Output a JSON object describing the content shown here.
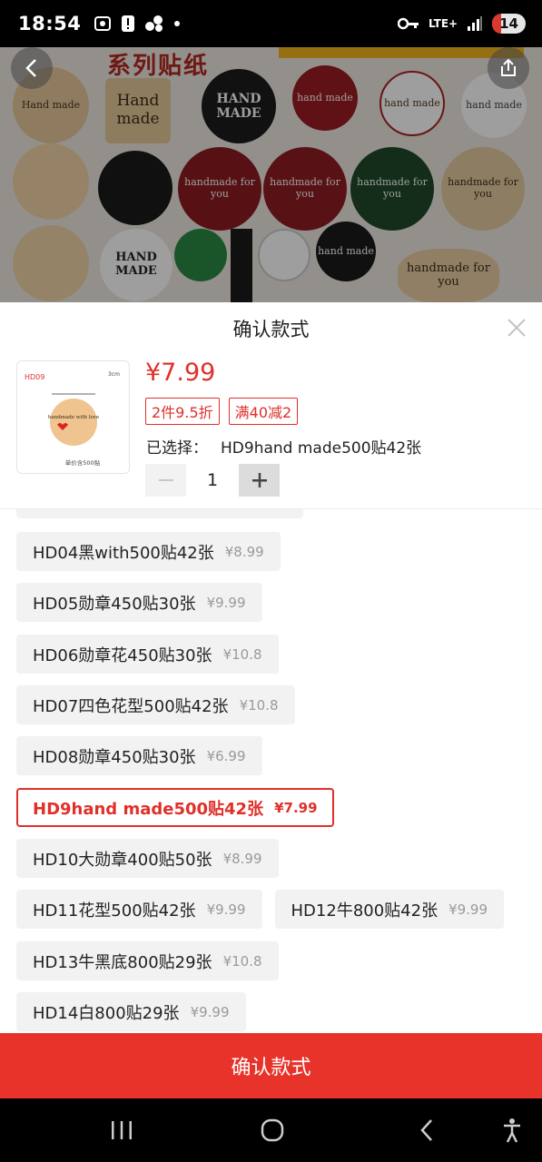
{
  "status_bar": {
    "time": "18:54",
    "network": "LTE+",
    "battery": "14",
    "icons": [
      "screenshot-icon",
      "alert-icon",
      "app-icon",
      "dot-icon",
      "key-icon",
      "signal-icon"
    ]
  },
  "background": {
    "title": "系列贴纸",
    "stickers": [
      "Hand made",
      "HAND MADE",
      "hand made",
      "handmade for you",
      "HAND MADE"
    ]
  },
  "sheet": {
    "title": "确认款式",
    "price": "¥7.99",
    "tags": [
      "2件9.5折",
      "满40减2"
    ],
    "selected_label": "已选择：",
    "selected_value": "HD9hand made500贴42张",
    "quantity": "1",
    "thumbnail": {
      "code": "HD09",
      "size": "3cm",
      "note": "单价含500贴",
      "text": "handmade with love"
    }
  },
  "options": [
    {
      "name": "HD04黑with500贴42张",
      "price": "¥8.99"
    },
    {
      "name": "HD05勋章450贴30张",
      "price": "¥9.99"
    },
    {
      "name": "HD06勋章花450贴30张",
      "price": "¥10.8"
    },
    {
      "name": "HD07四色花型500贴42张",
      "price": "¥10.8"
    },
    {
      "name": "HD08勋章450贴30张",
      "price": "¥6.99"
    },
    {
      "name": "HD9hand made500贴42张",
      "price": "¥7.99",
      "selected": true
    },
    {
      "name": "HD10大勋章400贴50张",
      "price": "¥8.99"
    },
    {
      "name": "HD11花型500贴42张",
      "price": "¥9.99"
    },
    {
      "name": "HD12牛800贴42张",
      "price": "¥9.99"
    },
    {
      "name": "HD13牛黑底800贴29张",
      "price": "¥10.8"
    },
    {
      "name": "HD14白800贴29张",
      "price": "¥9.99"
    }
  ],
  "confirm_label": "确认款式",
  "colors": {
    "accent": "#e0302a",
    "button": "#e8332a",
    "chip": "#f2f2f2"
  }
}
